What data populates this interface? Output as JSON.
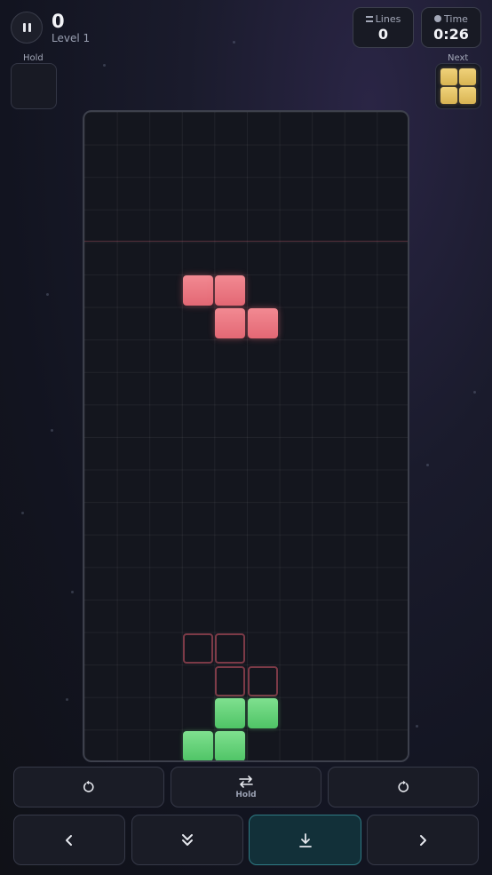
{
  "header": {
    "score": "0",
    "level": "Level 1",
    "lines_label": "Lines",
    "lines_value": "0",
    "time_label": "Time",
    "time_value": "0:26"
  },
  "hold": {
    "label": "Hold",
    "piece": null
  },
  "next": {
    "label": "Next",
    "piece": "O",
    "color": "#e8c86a"
  },
  "board": {
    "columns": 10,
    "rows": 20,
    "active_piece": {
      "type": "Z",
      "color": "#ec7680"
    },
    "ghost_piece": {
      "type": "Z"
    },
    "locked_piece": {
      "type": "S",
      "color": "#66d27a"
    }
  },
  "controls": {
    "rotate_ccw": "rotate-ccw-icon",
    "hold_label": "Hold",
    "rotate_cw": "rotate-cw-icon",
    "move_left": "chevron-left-icon",
    "soft_drop": "chevrons-down-icon",
    "hard_drop": "hard-drop-icon",
    "move_right": "chevron-right-icon"
  }
}
